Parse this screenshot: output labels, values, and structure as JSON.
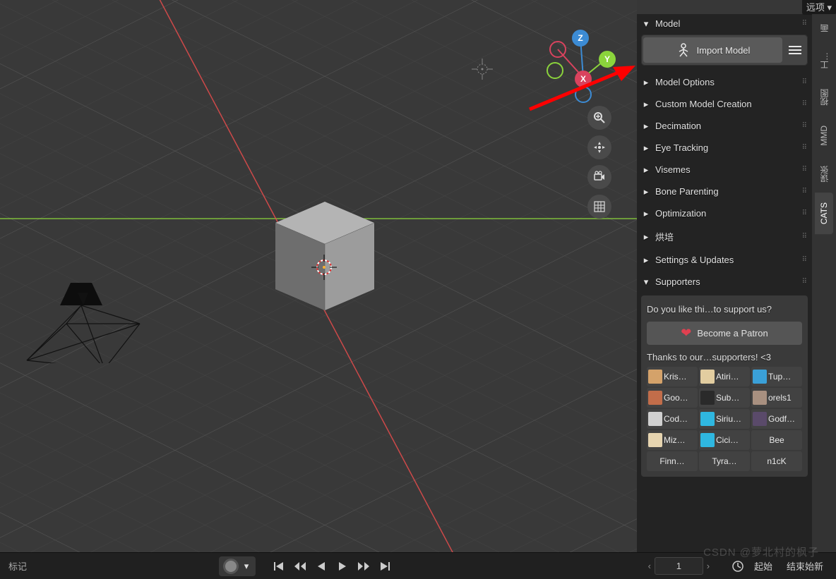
{
  "top_button": "远项",
  "panel": {
    "sections": {
      "model": "Model",
      "model_options": "Model Options",
      "custom_model": "Custom Model Creation",
      "decimation": "Decimation",
      "eye_tracking": "Eye Tracking",
      "visemes": "Visemes",
      "bone_parenting": "Bone Parenting",
      "optimization": "Optimization",
      "bake": "烘培",
      "settings_updates": "Settings & Updates",
      "supporters": "Supporters"
    },
    "import_button": "Import Model",
    "patron": {
      "question": "Do you like thi…to support us?",
      "button": "Become a Patron",
      "thanks": "Thanks to our…supporters! <3"
    },
    "supporter_cells": [
      {
        "name": "Kris…",
        "color": "#d4a26a"
      },
      {
        "name": "Atiri…",
        "color": "#e2cda0"
      },
      {
        "name": "Tup…",
        "color": "#3aa0d8"
      },
      {
        "name": "Goo…",
        "color": "#c26d4a"
      },
      {
        "name": "Sub…",
        "color": "#2a2a2a"
      },
      {
        "name": "orels1",
        "color": "#a89080"
      },
      {
        "name": "Cod…",
        "color": "#d0d0d0"
      },
      {
        "name": "Siriu…",
        "color": "#2fb7e0"
      },
      {
        "name": "Godf…",
        "color": "#5a4a6a"
      },
      {
        "name": "Miz…",
        "color": "#e6d4b0"
      },
      {
        "name": "Cici…",
        "color": "#2fb7e0"
      }
    ],
    "supporter_plain": [
      "Bee",
      "Finn…",
      "Tyra…",
      "n1cK"
    ]
  },
  "tabs": [
    "画",
    "工…",
    "视图",
    "MMD",
    "误张",
    "CATS"
  ],
  "active_tab": "CATS",
  "gizmo": {
    "x": "X",
    "y": "Y",
    "z": "Z"
  },
  "statusbar": {
    "label": "标记",
    "frame": "1",
    "start_label": "起始",
    "sync_label": "结束始新"
  },
  "watermark": "CSDN @萝北村的枫子"
}
